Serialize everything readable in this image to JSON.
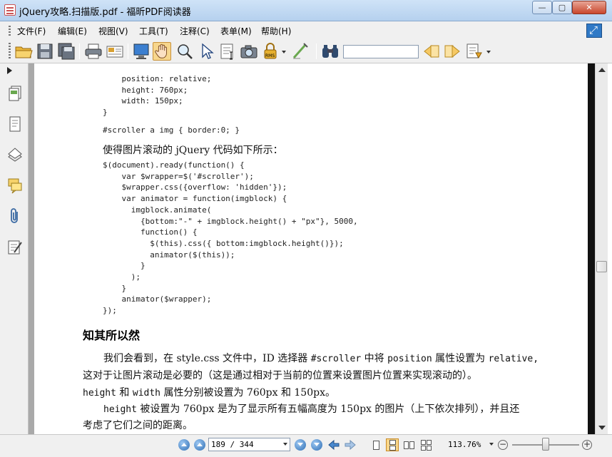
{
  "window": {
    "title": "jQuery攻略.扫描版.pdf - 福昕PDF阅读器",
    "min": "—",
    "max": "▢",
    "close": "✕"
  },
  "menu": [
    "文件(F)",
    "编辑(E)",
    "视图(V)",
    "工具(T)",
    "注释(C)",
    "表单(M)",
    "帮助(H)"
  ],
  "toolbar": {
    "search_placeholder": ""
  },
  "document": {
    "code_top": [
      "    position: relative;",
      "    height: 760px;",
      "    width: 150px;",
      "}"
    ],
    "css_line": "#scroller a img { border:0; }",
    "intro": "使得图片滚动的 jQuery 代码如下所示：",
    "code_main": [
      "$(document).ready(function() {",
      "    var $wrapper=$('#scroller');",
      "    $wrapper.css({overflow: 'hidden'});",
      "    var animator = function(imgblock) {",
      "      imgblock.animate(",
      "        {bottom:\"-\" + imgblock.height() + \"px\"}, 5000,",
      "        function() {",
      "          $(this).css({ bottom:imgblock.height()});",
      "          animator($(this));",
      "        }",
      "      );",
      "    }",
      "    animator($wrapper);",
      "});"
    ],
    "heading": "知其所以然",
    "p1": {
      "a": "我们会看到，在 style.css 文件中，ID 选择器",
      "b": "#scroller",
      "c": "中将",
      "d": "position",
      "e": "属性设置为",
      "f": "relative,",
      "line2": "这对于让图片滚动是必要的（这是通过相对于当前的位置来设置图片位置来实现滚动的）。",
      "l3a": "height",
      "l3b": "和",
      "l3c": "width",
      "l3d": "属性分别被设置为 760px 和 150px。"
    },
    "p2": {
      "a": "height",
      "b": "被设置为 760px 是为了显示所有五幅高度为 150px 的图片（上下依次排列），并且还",
      "line2": "考虑了它们之间的距离。"
    }
  },
  "status": {
    "page_field": "189 / 344",
    "zoom": "113.76%",
    "zoom_out": "−",
    "zoom_in": "+",
    "zoom_level": 0.45
  }
}
